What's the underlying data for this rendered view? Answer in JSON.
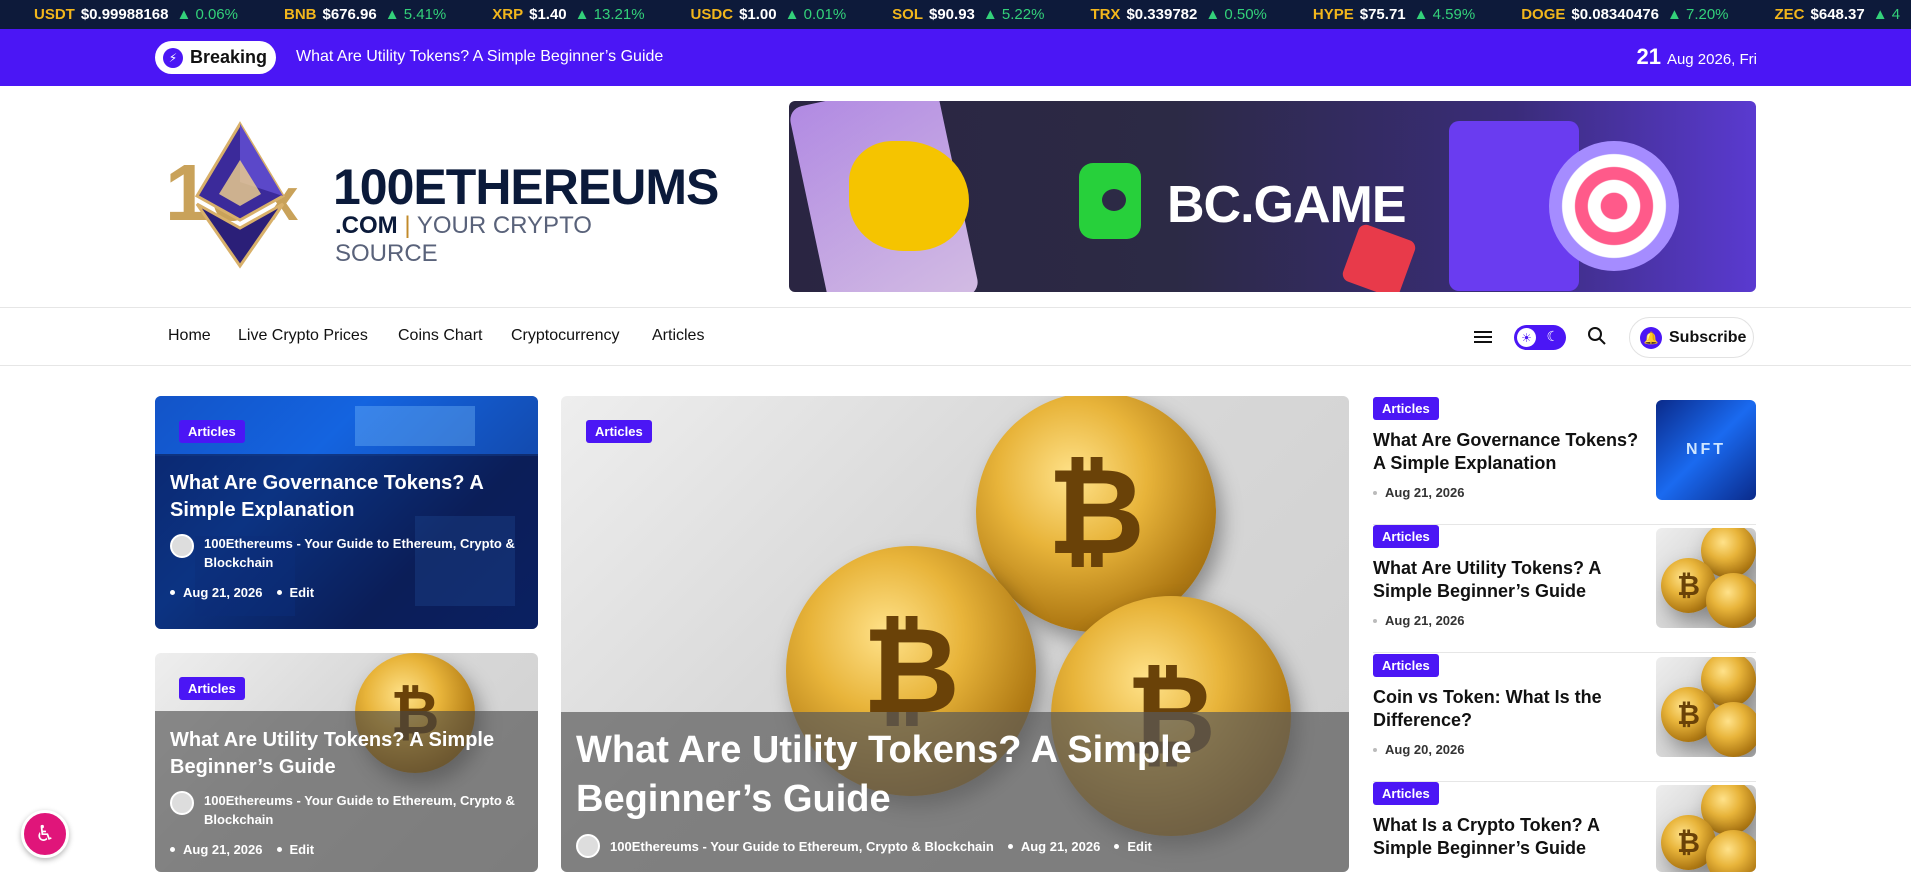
{
  "ticker": [
    {
      "sym": "USDT",
      "price": "$0.99988168",
      "chg": "▲ 0.06%"
    },
    {
      "sym": "BNB",
      "price": "$676.96",
      "chg": "▲ 5.41%"
    },
    {
      "sym": "XRP",
      "price": "$1.40",
      "chg": "▲ 13.21%"
    },
    {
      "sym": "USDC",
      "price": "$1.00",
      "chg": "▲ 0.01%"
    },
    {
      "sym": "SOL",
      "price": "$90.93",
      "chg": "▲ 5.22%"
    },
    {
      "sym": "TRX",
      "price": "$0.339782",
      "chg": "▲ 0.50%"
    },
    {
      "sym": "HYPE",
      "price": "$75.71",
      "chg": "▲ 4.59%"
    },
    {
      "sym": "DOGE",
      "price": "$0.08340476",
      "chg": "▲ 7.20%"
    },
    {
      "sym": "ZEC",
      "price": "$648.37",
      "chg": "▲ 4"
    }
  ],
  "breaking": {
    "label": "Breaking",
    "title": "What Are Utility Tokens? A Simple Beginner’s Guide",
    "day": "21",
    "date_rest": "Aug 2026, Fri"
  },
  "logo": {
    "main": "100ETHEREUMS",
    "dotcom": ".COM",
    "sep": " | ",
    "tagline": "YOUR CRYPTO SOURCE"
  },
  "banner": {
    "text": "BC.GAME"
  },
  "nav": {
    "items": [
      "Home",
      "Live Crypto Prices",
      "Coins Chart",
      "Cryptocurrency",
      "Articles"
    ],
    "subscribe": "Subscribe"
  },
  "cards": {
    "left_top": {
      "tag": "Articles",
      "title": "What Are Governance Tokens? A Simple Explanation",
      "author": "100Ethereums - Your Guide to Ethereum, Crypto & Blockchain",
      "date": "Aug 21, 2026",
      "edit": "Edit"
    },
    "left_bottom": {
      "tag": "Articles",
      "title": "What Are Utility Tokens? A Simple Beginner’s Guide",
      "author": "100Ethereums - Your Guide to Ethereum, Crypto & Blockchain",
      "date": "Aug 21, 2026",
      "edit": "Edit"
    },
    "main": {
      "tag": "Articles",
      "title": "What Are Utility Tokens? A Simple Beginner’s Guide",
      "author": "100Ethereums - Your Guide to Ethereum, Crypto & Blockchain",
      "date": "Aug 21, 2026",
      "edit": "Edit"
    }
  },
  "sidebar": [
    {
      "tag": "Articles",
      "title": "What Are Governance Tokens? A Simple Explanation",
      "date": "Aug 21, 2026",
      "thumb": "NFT"
    },
    {
      "tag": "Articles",
      "title": "What Are Utility Tokens? A Simple Beginner’s Guide",
      "date": "Aug 21, 2026",
      "thumb": "coins"
    },
    {
      "tag": "Articles",
      "title": "Coin vs Token: What Is the Difference?",
      "date": "Aug 20, 2026",
      "thumb": "coins"
    },
    {
      "tag": "Articles",
      "title": "What Is a Crypto Token? A Simple Beginner’s Guide",
      "date": "",
      "thumb": "coins"
    }
  ],
  "colors": {
    "accent": "#4b16f5",
    "ticker_bg": "#0d1a3a",
    "up": "#33d17a",
    "symbol": "#f2b61c"
  }
}
